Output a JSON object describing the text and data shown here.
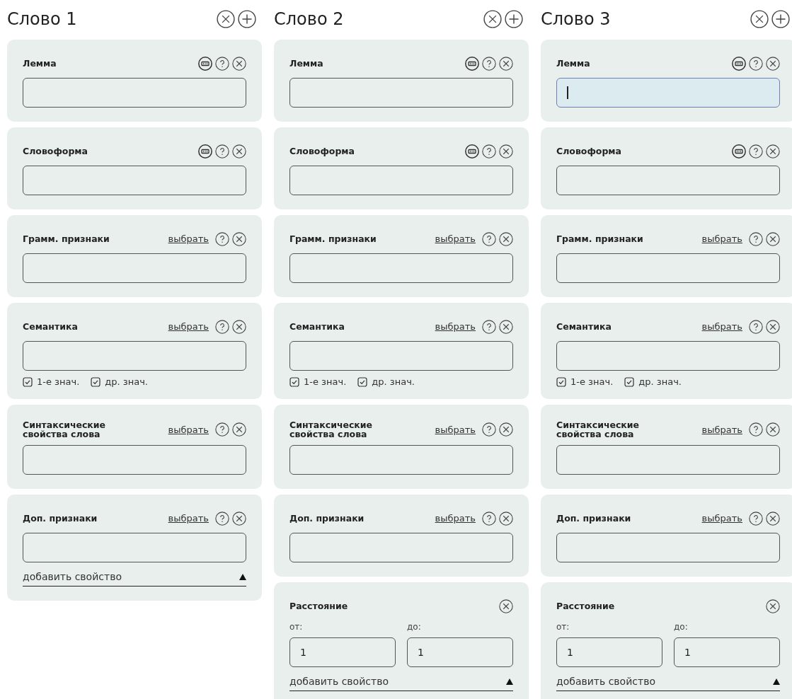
{
  "words": [
    {
      "title": "Слово 1",
      "fields": [
        {
          "label": "Лемма",
          "kind": "keyboard",
          "focused": false
        },
        {
          "label": "Словоформа",
          "kind": "keyboard",
          "focused": false
        },
        {
          "label": "Грамм. признаки",
          "kind": "select",
          "select_label": "выбрать",
          "focused": false
        },
        {
          "label": "Семантика",
          "kind": "select",
          "select_label": "выбрать",
          "focused": false,
          "checkboxes": [
            {
              "label": "1-е знач.",
              "checked": true
            },
            {
              "label": "др. знач.",
              "checked": true
            }
          ]
        },
        {
          "label": "Синтаксические свойства слова",
          "kind": "select",
          "select_label": "выбрать",
          "focused": false
        },
        {
          "label": "Доп. признаки",
          "kind": "select",
          "select_label": "выбрать",
          "focused": false
        }
      ],
      "add_property": "добавить свойство"
    },
    {
      "title": "Слово 2",
      "fields": [
        {
          "label": "Лемма",
          "kind": "keyboard",
          "focused": false
        },
        {
          "label": "Словоформа",
          "kind": "keyboard",
          "focused": false
        },
        {
          "label": "Грамм. признаки",
          "kind": "select",
          "select_label": "выбрать",
          "focused": false
        },
        {
          "label": "Семантика",
          "kind": "select",
          "select_label": "выбрать",
          "focused": false,
          "checkboxes": [
            {
              "label": "1-е знач.",
              "checked": true
            },
            {
              "label": "др. знач.",
              "checked": true
            }
          ]
        },
        {
          "label": "Синтаксические свойства слова",
          "kind": "select",
          "select_label": "выбрать",
          "focused": false
        },
        {
          "label": "Доп. признаки",
          "kind": "select",
          "select_label": "выбрать",
          "focused": false
        }
      ],
      "distance": {
        "label": "Расстояние",
        "from_label": "от:",
        "from_value": "1",
        "to_label": "до:",
        "to_value": "1"
      },
      "add_property": "добавить свойство"
    },
    {
      "title": "Слово 3",
      "fields": [
        {
          "label": "Лемма",
          "kind": "keyboard",
          "focused": true
        },
        {
          "label": "Словоформа",
          "kind": "keyboard",
          "focused": false
        },
        {
          "label": "Грамм. признаки",
          "kind": "select",
          "select_label": "выбрать",
          "focused": false
        },
        {
          "label": "Семантика",
          "kind": "select",
          "select_label": "выбрать",
          "focused": false,
          "checkboxes": [
            {
              "label": "1-е знач.",
              "checked": true
            },
            {
              "label": "др. знач.",
              "checked": true
            }
          ]
        },
        {
          "label": "Синтаксические свойства слова",
          "kind": "select",
          "select_label": "выбрать",
          "focused": false
        },
        {
          "label": "Доп. признаки",
          "kind": "select",
          "select_label": "выбрать",
          "focused": false
        }
      ],
      "distance": {
        "label": "Расстояние",
        "from_label": "от:",
        "from_value": "1",
        "to_label": "до:",
        "to_value": "1"
      },
      "add_property": "добавить свойство"
    }
  ]
}
